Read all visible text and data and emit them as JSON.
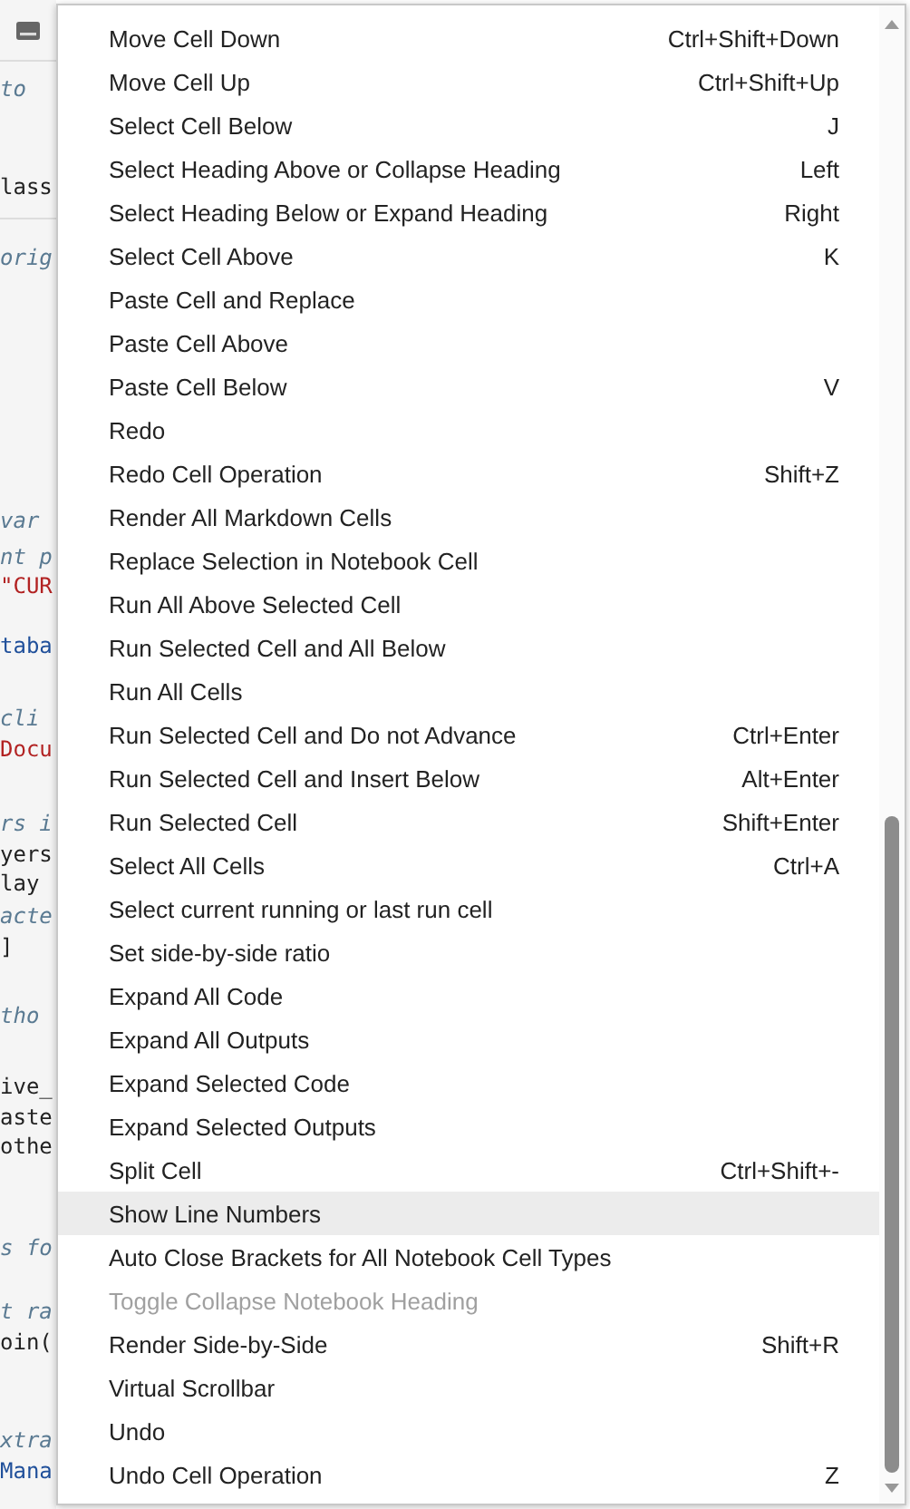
{
  "notebook_behind": {
    "lines": [
      {
        "text": "to",
        "kind": "comment"
      },
      {
        "text": "lass",
        "kind": "code"
      },
      {
        "text": "orig",
        "kind": "comment"
      },
      {
        "text": "var",
        "kind": "comment"
      },
      {
        "text": "nt p",
        "kind": "comment"
      },
      {
        "text": "\"CUR",
        "kind": "string"
      },
      {
        "text": "taba",
        "kind": "name"
      },
      {
        "text": "cli",
        "kind": "comment"
      },
      {
        "text": "Docu",
        "kind": "string"
      },
      {
        "text": "rs i",
        "kind": "comment"
      },
      {
        "text": "yers",
        "kind": "code"
      },
      {
        "text": "lay",
        "kind": "code"
      },
      {
        "text": "acte",
        "kind": "comment"
      },
      {
        "text": "]",
        "kind": "code"
      },
      {
        "text": "tho",
        "kind": "comment"
      },
      {
        "text": "ive_",
        "kind": "code"
      },
      {
        "text": "aste",
        "kind": "code"
      },
      {
        "text": "othe",
        "kind": "code"
      },
      {
        "text": "s fo",
        "kind": "comment"
      },
      {
        "text": "t ra",
        "kind": "comment"
      },
      {
        "text": "oin(",
        "kind": "code"
      },
      {
        "text": "xtra",
        "kind": "comment"
      },
      {
        "text": "Mana",
        "kind": "name"
      }
    ]
  },
  "menu": {
    "items": [
      {
        "label": "Move Cell Down",
        "shortcut": "Ctrl+Shift+Down",
        "selected": false,
        "disabled": false
      },
      {
        "label": "Move Cell Up",
        "shortcut": "Ctrl+Shift+Up",
        "selected": false,
        "disabled": false
      },
      {
        "label": "Select Cell Below",
        "shortcut": "J",
        "selected": false,
        "disabled": false
      },
      {
        "label": "Select Heading Above or Collapse Heading",
        "shortcut": "Left",
        "selected": false,
        "disabled": false
      },
      {
        "label": "Select Heading Below or Expand Heading",
        "shortcut": "Right",
        "selected": false,
        "disabled": false
      },
      {
        "label": "Select Cell Above",
        "shortcut": "K",
        "selected": false,
        "disabled": false
      },
      {
        "label": "Paste Cell and Replace",
        "selected": false,
        "disabled": false
      },
      {
        "label": "Paste Cell Above",
        "selected": false,
        "disabled": false
      },
      {
        "label": "Paste Cell Below",
        "shortcut": "V",
        "selected": false,
        "disabled": false
      },
      {
        "label": "Redo",
        "selected": false,
        "disabled": false
      },
      {
        "label": "Redo Cell Operation",
        "shortcut": "Shift+Z",
        "selected": false,
        "disabled": false
      },
      {
        "label": "Render All Markdown Cells",
        "selected": false,
        "disabled": false
      },
      {
        "label": "Replace Selection in Notebook Cell",
        "selected": false,
        "disabled": false
      },
      {
        "label": "Run All Above Selected Cell",
        "selected": false,
        "disabled": false
      },
      {
        "label": "Run Selected Cell and All Below",
        "selected": false,
        "disabled": false
      },
      {
        "label": "Run All Cells",
        "selected": false,
        "disabled": false
      },
      {
        "label": "Run Selected Cell and Do not Advance",
        "shortcut": "Ctrl+Enter",
        "selected": false,
        "disabled": false
      },
      {
        "label": "Run Selected Cell and Insert Below",
        "shortcut": "Alt+Enter",
        "selected": false,
        "disabled": false
      },
      {
        "label": "Run Selected Cell",
        "shortcut": "Shift+Enter",
        "selected": false,
        "disabled": false
      },
      {
        "label": "Select All Cells",
        "shortcut": "Ctrl+A",
        "selected": false,
        "disabled": false
      },
      {
        "label": "Select current running or last run cell",
        "selected": false,
        "disabled": false
      },
      {
        "label": "Set side-by-side ratio",
        "selected": false,
        "disabled": false
      },
      {
        "label": "Expand All Code",
        "selected": false,
        "disabled": false
      },
      {
        "label": "Expand All Outputs",
        "selected": false,
        "disabled": false
      },
      {
        "label": "Expand Selected Code",
        "selected": false,
        "disabled": false
      },
      {
        "label": "Expand Selected Outputs",
        "selected": false,
        "disabled": false
      },
      {
        "label": "Split Cell",
        "shortcut": "Ctrl+Shift+-",
        "selected": false,
        "disabled": false
      },
      {
        "label": "Show Line Numbers",
        "selected": true,
        "disabled": false
      },
      {
        "label": "Auto Close Brackets for All Notebook Cell Types",
        "selected": false,
        "disabled": false
      },
      {
        "label": "Toggle Collapse Notebook Heading",
        "selected": false,
        "disabled": true
      },
      {
        "label": "Render Side-by-Side",
        "shortcut": "Shift+R",
        "selected": false,
        "disabled": false
      },
      {
        "label": "Virtual Scrollbar",
        "selected": false,
        "disabled": false
      },
      {
        "label": "Undo",
        "selected": false,
        "disabled": false
      },
      {
        "label": "Undo Cell Operation",
        "shortcut": "Z",
        "selected": false,
        "disabled": false
      }
    ]
  }
}
